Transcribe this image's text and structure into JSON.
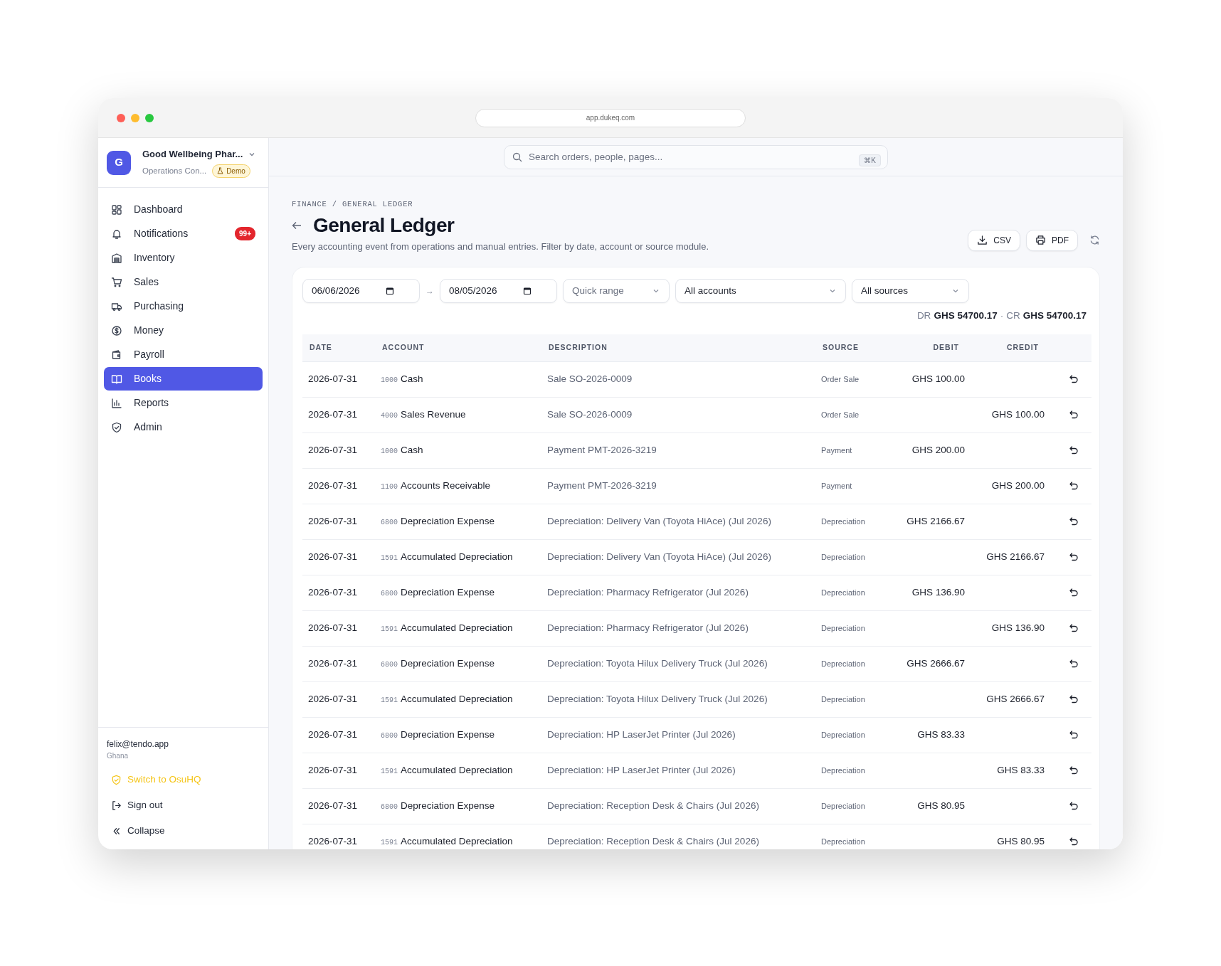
{
  "window": {
    "url": "app.dukeq.com"
  },
  "org": {
    "initial": "G",
    "name": "Good Wellbeing Phar...",
    "subtitle": "Operations Con...",
    "badge": "Demo"
  },
  "nav": [
    {
      "label": "Dashboard",
      "selected": false
    },
    {
      "label": "Notifications",
      "badge": "99+",
      "selected": false
    },
    {
      "label": "Inventory",
      "selected": false
    },
    {
      "label": "Sales",
      "selected": false
    },
    {
      "label": "Purchasing",
      "selected": false
    },
    {
      "label": "Money",
      "selected": false
    },
    {
      "label": "Payroll",
      "selected": false
    },
    {
      "label": "Books",
      "selected": true
    },
    {
      "label": "Reports",
      "selected": false
    },
    {
      "label": "Admin",
      "selected": false
    }
  ],
  "user": {
    "email": "felix@tendo.app",
    "country": "Ghana"
  },
  "footer_links": [
    {
      "label": "Switch to OsuHQ",
      "kind": "switch"
    },
    {
      "label": "Sign out",
      "kind": "signout"
    },
    {
      "label": "Collapse",
      "kind": "collapse"
    }
  ],
  "search": {
    "placeholder": "Search orders, people, pages...",
    "shortcut": "⌘K"
  },
  "breadcrumb": "FINANCE / GENERAL LEDGER",
  "title": "General Ledger",
  "subtitle": "Every accounting event from operations and manual entries. Filter by date, account or source module.",
  "actions": [
    {
      "label": "CSV",
      "kind": "download"
    },
    {
      "label": "PDF",
      "kind": "print"
    }
  ],
  "filters": {
    "date_from": "06/06/2026",
    "separator": "→",
    "date_to": "08/05/2026",
    "quick_range": {
      "placeholder": "Quick range"
    },
    "account": "All accounts",
    "source": "All sources"
  },
  "totals": {
    "dr_label": "DR",
    "dr_value": "GHS 54700.17",
    "separator": "·",
    "cr_label": "CR",
    "cr_value": "GHS 54700.17"
  },
  "table": {
    "columns": [
      "DATE",
      "ACCOUNT",
      "DESCRIPTION",
      "SOURCE",
      "DEBIT",
      "CREDIT"
    ],
    "rows": [
      {
        "date": "2026-07-31",
        "account_code": "1000",
        "account_name": "Cash",
        "description": "Sale SO-2026-0009",
        "source": "Order Sale",
        "debit": "GHS 100.00"
      },
      {
        "date": "2026-07-31",
        "account_code": "4000",
        "account_name": "Sales Revenue",
        "description": "Sale SO-2026-0009",
        "source": "Order Sale",
        "credit": "GHS 100.00"
      },
      {
        "date": "2026-07-31",
        "account_code": "1000",
        "account_name": "Cash",
        "description": "Payment PMT-2026-3219",
        "source": "Payment",
        "debit": "GHS 200.00"
      },
      {
        "date": "2026-07-31",
        "account_code": "1100",
        "account_name": "Accounts Receivable",
        "description": "Payment PMT-2026-3219",
        "source": "Payment",
        "credit": "GHS 200.00"
      },
      {
        "date": "2026-07-31",
        "account_code": "6800",
        "account_name": "Depreciation Expense",
        "description": "Depreciation: Delivery Van (Toyota HiAce) (Jul 2026)",
        "source": "Depreciation",
        "debit": "GHS 2166.67"
      },
      {
        "date": "2026-07-31",
        "account_code": "1591",
        "account_name": "Accumulated Depreciation",
        "description": "Depreciation: Delivery Van (Toyota HiAce) (Jul 2026)",
        "source": "Depreciation",
        "credit": "GHS 2166.67"
      },
      {
        "date": "2026-07-31",
        "account_code": "6800",
        "account_name": "Depreciation Expense",
        "description": "Depreciation: Pharmacy Refrigerator (Jul 2026)",
        "source": "Depreciation",
        "debit": "GHS 136.90"
      },
      {
        "date": "2026-07-31",
        "account_code": "1591",
        "account_name": "Accumulated Depreciation",
        "description": "Depreciation: Pharmacy Refrigerator (Jul 2026)",
        "source": "Depreciation",
        "credit": "GHS 136.90"
      },
      {
        "date": "2026-07-31",
        "account_code": "6800",
        "account_name": "Depreciation Expense",
        "description": "Depreciation: Toyota Hilux Delivery Truck (Jul 2026)",
        "source": "Depreciation",
        "debit": "GHS 2666.67"
      },
      {
        "date": "2026-07-31",
        "account_code": "1591",
        "account_name": "Accumulated Depreciation",
        "description": "Depreciation: Toyota Hilux Delivery Truck (Jul 2026)",
        "source": "Depreciation",
        "credit": "GHS 2666.67"
      },
      {
        "date": "2026-07-31",
        "account_code": "6800",
        "account_name": "Depreciation Expense",
        "description": "Depreciation: HP LaserJet Printer (Jul 2026)",
        "source": "Depreciation",
        "debit": "GHS 83.33"
      },
      {
        "date": "2026-07-31",
        "account_code": "1591",
        "account_name": "Accumulated Depreciation",
        "description": "Depreciation: HP LaserJet Printer (Jul 2026)",
        "source": "Depreciation",
        "credit": "GHS 83.33"
      },
      {
        "date": "2026-07-31",
        "account_code": "6800",
        "account_name": "Depreciation Expense",
        "description": "Depreciation: Reception Desk & Chairs (Jul 2026)",
        "source": "Depreciation",
        "debit": "GHS 80.95"
      },
      {
        "date": "2026-07-31",
        "account_code": "1591",
        "account_name": "Accumulated Depreciation",
        "description": "Depreciation: Reception Desk & Chairs (Jul 2026)",
        "source": "Depreciation",
        "credit": "GHS 80.95"
      }
    ]
  }
}
